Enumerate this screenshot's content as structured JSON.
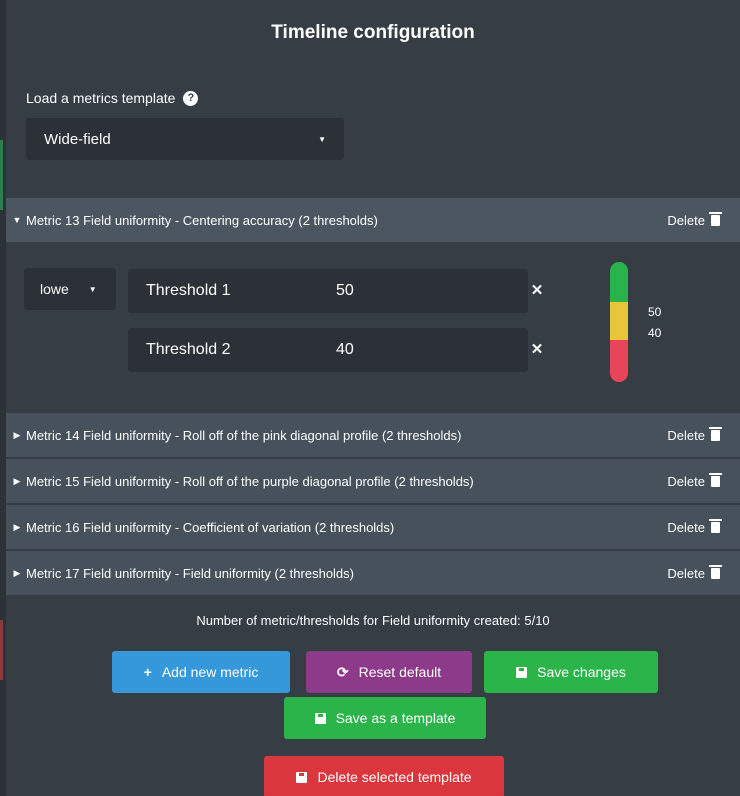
{
  "title": "Timeline configuration",
  "template": {
    "label": "Load a metrics template",
    "selected": "Wide-field"
  },
  "expanded_metric": {
    "label": "Metric 13  Field uniformity - Centering accuracy  (2 thresholds)",
    "delete_label": "Delete",
    "direction": "lowe",
    "thresholds": [
      {
        "name": "Threshold 1",
        "value": "50"
      },
      {
        "name": "Threshold 2",
        "value": "40"
      }
    ],
    "gauge": {
      "labels": [
        "50",
        "40"
      ],
      "colors": {
        "high": "#29b34a",
        "mid": "#e9c53a",
        "low": "#e8455a"
      }
    }
  },
  "metrics": [
    {
      "label": "Metric 14  Field uniformity - Roll off of the pink diagonal profile  (2 thresholds)",
      "delete_label": "Delete"
    },
    {
      "label": "Metric 15  Field uniformity - Roll off of the purple diagonal profile  (2 thresholds)",
      "delete_label": "Delete"
    },
    {
      "label": "Metric 16  Field uniformity - Coefficient of variation  (2 thresholds)",
      "delete_label": "Delete"
    },
    {
      "label": "Metric 17  Field uniformity - Field uniformity  (2 thresholds)",
      "delete_label": "Delete"
    }
  ],
  "count_text": "Number of metric/thresholds for Field uniformity created: 5/10",
  "buttons": {
    "add": "Add new metric",
    "reset": "Reset default",
    "save": "Save changes",
    "save_template": "Save as a template",
    "delete_template": "Delete selected template"
  },
  "colors": {
    "add": "#3498db",
    "reset": "#8e3a8a",
    "save": "#2bb44a",
    "delete": "#d9363e"
  }
}
